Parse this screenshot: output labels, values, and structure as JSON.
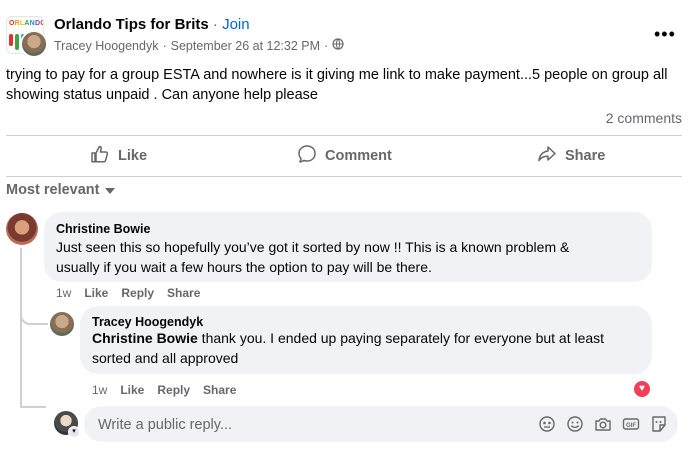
{
  "post": {
    "group_name": "Orlando Tips for Brits",
    "separator": "·",
    "join_label": "Join",
    "author": "Tracey Hoogendyk",
    "meta_sep": "·",
    "timestamp": "September 26 at 12:32 PM",
    "meta_sep2": "·",
    "more_label": "•••",
    "group_logo_text": "ORLANDO",
    "text": "trying to pay for a group ESTA and nowhere is it giving me link to make payment...5 people on group all showing status unpaid .  Can anyone help please",
    "comment_count": "2 comments"
  },
  "actions": {
    "like": "Like",
    "comment": "Comment",
    "share": "Share"
  },
  "sort": {
    "label": "Most relevant"
  },
  "comments": [
    {
      "name": "Christine Bowie",
      "text_line1": "Just seen this so hopefully you’ve got it sorted by now !! This is a known problem &",
      "text_line2": "usually if you wait a few hours the option to pay will be there.",
      "time": "1w",
      "like": "Like",
      "reply": "Reply",
      "share": "Share"
    },
    {
      "name": "Tracey Hoogendyk",
      "mention": "Christine Bowie",
      "text_line1_rest": " thank you. I ended up paying separately for everyone but at least",
      "text_line2": "sorted and all approved",
      "time": "1w",
      "like": "Like",
      "reply": "Reply",
      "share": "Share",
      "reaction": "heart"
    }
  ],
  "reply": {
    "placeholder": "Write a public reply..."
  },
  "colors": {
    "accent": "#0064d1",
    "muted": "#65676b",
    "bubble": "#f0f2f5",
    "heart": "#f33e58"
  }
}
